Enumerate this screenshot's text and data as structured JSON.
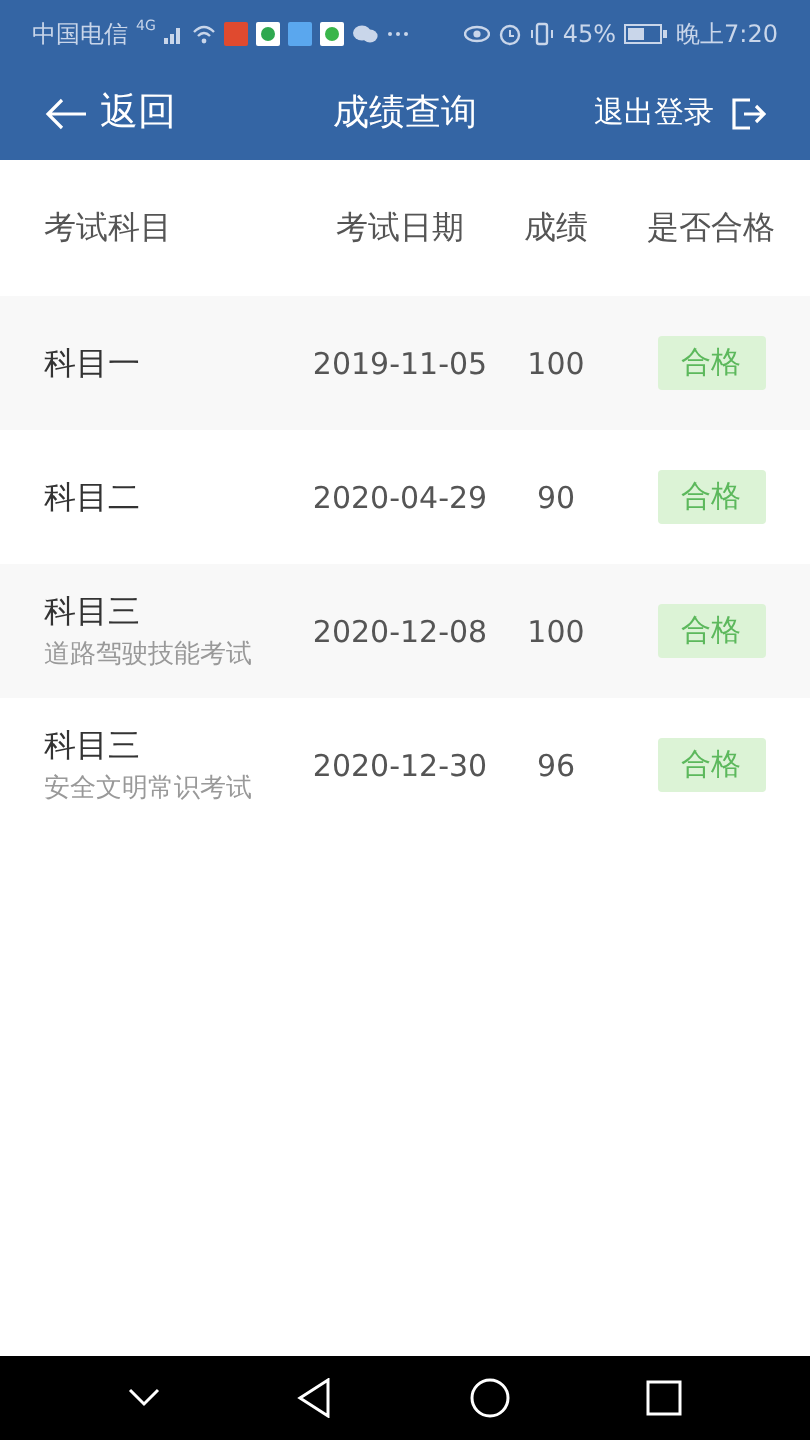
{
  "status_bar": {
    "carrier": "中国电信",
    "network": "4G",
    "battery": "45%",
    "time": "晚上7:20"
  },
  "header": {
    "back": "返回",
    "title": "成绩查询",
    "logout": "退出登录"
  },
  "table": {
    "columns": [
      "考试科目",
      "考试日期",
      "成绩",
      "是否合格"
    ],
    "rows": [
      {
        "subject": "科目一",
        "date": "2019-11-05",
        "score": "100",
        "result": "合格",
        "passed": true
      },
      {
        "subject": "科目二",
        "date": "2020-04-29",
        "score": "90",
        "result": "合格",
        "passed": true
      },
      {
        "subject": "科目三",
        "note": "道路驾驶技能考试",
        "date": "2020-12-08",
        "score": "100",
        "result": "合格",
        "passed": true
      },
      {
        "subject": "科目三",
        "note": "安全文明常识考试",
        "date": "2020-12-30",
        "score": "96",
        "result": "合格",
        "passed": true
      }
    ]
  }
}
